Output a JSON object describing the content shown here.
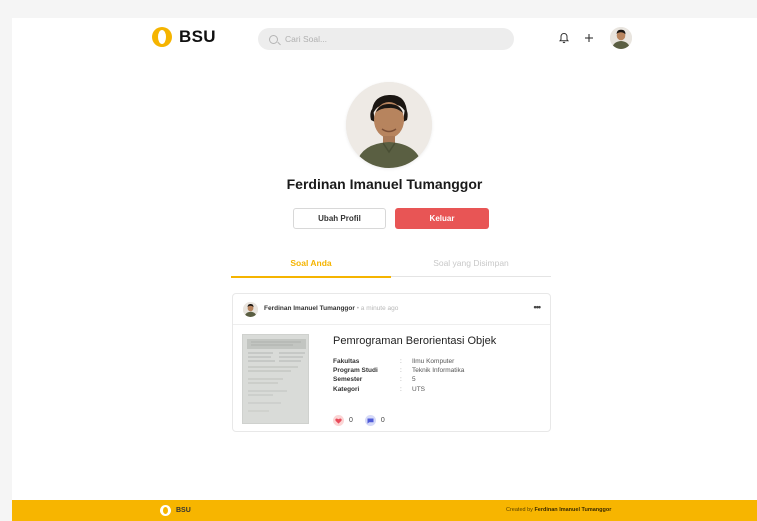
{
  "header": {
    "brand": "BSU",
    "search_placeholder": "Cari Soal..."
  },
  "profile": {
    "name": "Ferdinan Imanuel Tumanggor",
    "edit_label": "Ubah Profil",
    "logout_label": "Keluar"
  },
  "tabs": [
    {
      "label": "Soal Anda",
      "active": true
    },
    {
      "label": "Soal yang Disimpan",
      "active": false
    }
  ],
  "post": {
    "author": "Ferdinan Imanuel Tumanggor",
    "time": "• a minute ago",
    "more": "•••",
    "title": "Pemrograman Berorientasi Objek",
    "fields": [
      {
        "key": "Fakultas",
        "sep": ":",
        "value": "Ilmu Komputer"
      },
      {
        "key": "Program Studi",
        "sep": ":",
        "value": "Teknik Informatika"
      },
      {
        "key": "Semester",
        "sep": ":",
        "value": "5"
      },
      {
        "key": "Kategori",
        "sep": ":",
        "value": "UTS"
      }
    ],
    "likes": "0",
    "comments": "0"
  },
  "footer": {
    "brand": "BSU",
    "credit_prefix": "Created by",
    "credit_name": "Ferdinan Imanuel Tumanggor"
  },
  "colors": {
    "accent": "#f5b400",
    "logout": "#e85555",
    "footer": "#f7b500"
  },
  "icons": [
    "search-icon",
    "bell-icon",
    "plus-icon",
    "heart-icon",
    "comment-icon",
    "more-icon"
  ]
}
